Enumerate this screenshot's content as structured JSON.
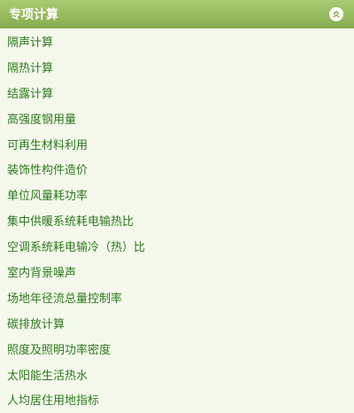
{
  "panel": {
    "title": "专项计算",
    "collapse_icon": "double-chevron-up-icon",
    "accent_color": "#8fb458",
    "link_color": "#2e7a1e",
    "items": [
      {
        "label": "隔声计算"
      },
      {
        "label": "隔热计算"
      },
      {
        "label": "结露计算"
      },
      {
        "label": "高强度钢用量"
      },
      {
        "label": "可再生材料利用"
      },
      {
        "label": "装饰性构件造价"
      },
      {
        "label": "单位风量耗功率"
      },
      {
        "label": "集中供暖系统耗电输热比"
      },
      {
        "label": "空调系统耗电输冷（热）比"
      },
      {
        "label": "室内背景噪声"
      },
      {
        "label": "场地年径流总量控制率"
      },
      {
        "label": "碳排放计算"
      },
      {
        "label": "照度及照明功率密度"
      },
      {
        "label": "太阳能生活热水"
      },
      {
        "label": "人均居住用地指标"
      }
    ]
  }
}
